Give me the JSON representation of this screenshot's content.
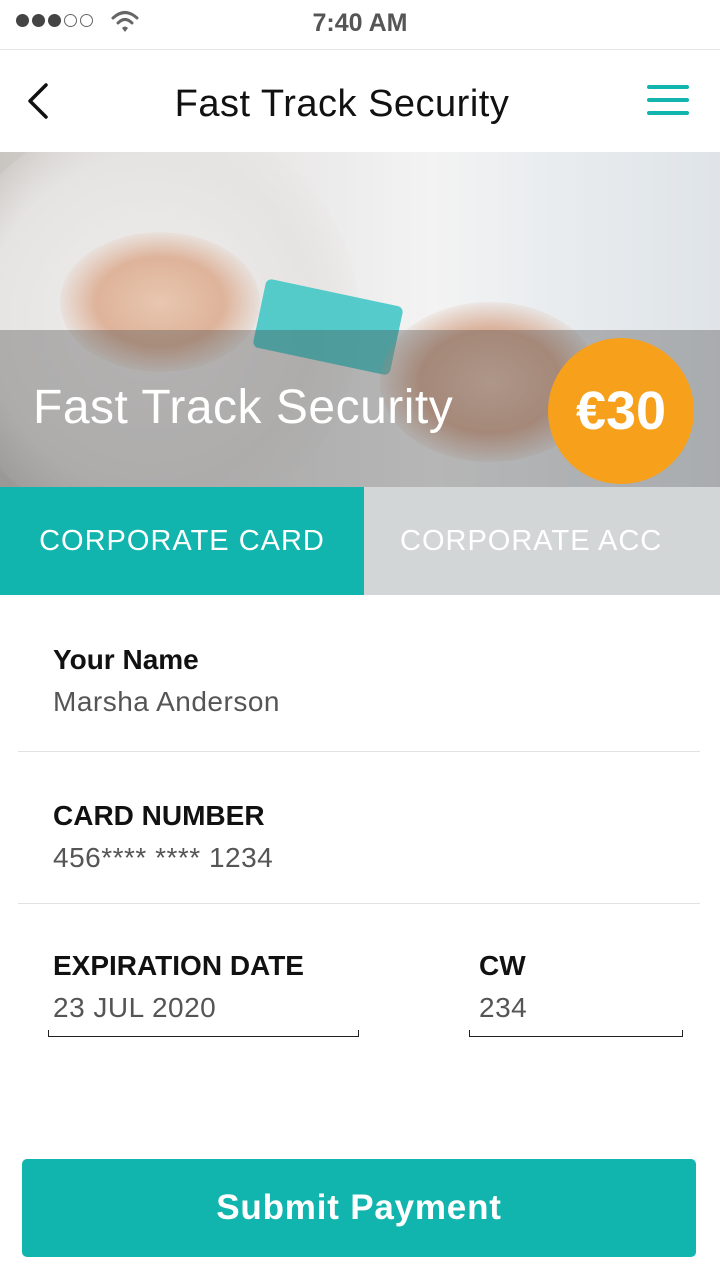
{
  "status_bar": {
    "time": "7:40 AM"
  },
  "header": {
    "title": "Fast Track Security"
  },
  "hero": {
    "title": "Fast Track Security",
    "price": "€30"
  },
  "tabs": [
    {
      "label": "CORPORATE CARD",
      "active": true
    },
    {
      "label": "CORPORATE ACC",
      "active": false
    }
  ],
  "form": {
    "name": {
      "label": "Your Name",
      "value": "Marsha Anderson"
    },
    "card_number": {
      "label": "CARD NUMBER",
      "value": "456**** **** 1234"
    },
    "expiration": {
      "label": "EXPIRATION DATE",
      "value": "23 JUL 2020"
    },
    "cvv": {
      "label": "CW",
      "value": "234"
    }
  },
  "submit": {
    "label": "Submit Payment"
  },
  "colors": {
    "accent": "#12b5ad",
    "badge": "#f7a01c",
    "inactive_tab": "#d3d6d7"
  },
  "icons": {
    "back": "chevron-left-icon",
    "menu": "hamburger-menu-icon",
    "wifi": "wifi-icon",
    "signal": "signal-dots-icon"
  }
}
